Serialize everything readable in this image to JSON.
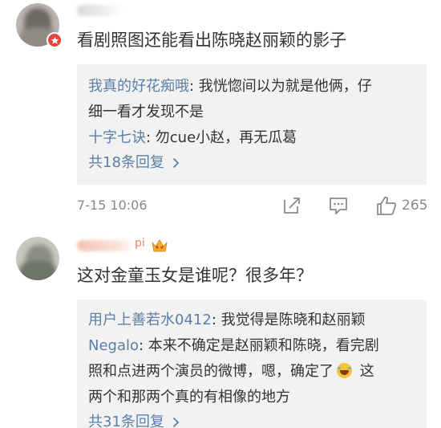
{
  "comments": [
    {
      "username_visible": "",
      "text": "看剧照图还能看出陈晓赵丽颖的影子",
      "replies": [
        {
          "user": "我真的好花痴哦",
          "text": ": 我恍惚间以为就是他俩，仔",
          "text_cont": "细一看才发现不是"
        },
        {
          "user": "十字七诀",
          "text": ": 勿cue小赵，再无瓜葛"
        }
      ],
      "more_replies": "共18条回复",
      "time": "7-15 10:06",
      "like_count": "265"
    },
    {
      "username_visible": "pi",
      "text": "这对金童玉女是谁呢？很多年？",
      "replies": [
        {
          "user": "用户上善若水0412",
          "text": ": 我觉得是陈晓和赵丽颖"
        },
        {
          "user": "Negalo",
          "text": ": 本来不确定是赵丽颖和陈晓，看完剧",
          "text_cont": "照和点进两个演员的微博，嗯，确定了",
          "text_cont_after": "  这",
          "text_cont2": "两个和那两个真的有相像的地方"
        }
      ],
      "more_replies": "共31条回复"
    }
  ],
  "icons": {
    "badge": "verified-badge-icon",
    "crown": "crown-icon",
    "share": "share-icon",
    "comment": "comment-icon",
    "like": "like-icon",
    "chevron": "chevron-right-icon",
    "emoji": "laughing-crying-emoji"
  },
  "colors": {
    "link": "#5b7fa6",
    "reply_bg": "#f2f2f2",
    "meta": "#888888",
    "badge": "#e8463a"
  }
}
